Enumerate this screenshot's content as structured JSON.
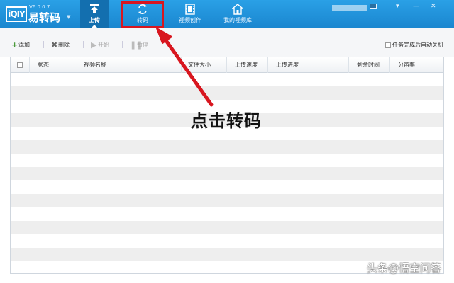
{
  "app": {
    "version": "V6.0.0.7",
    "name": "易转码",
    "logo_text": "iQIY"
  },
  "tabs": [
    {
      "label": "上传",
      "icon": "upload-icon",
      "active": true
    },
    {
      "label": "转码",
      "icon": "convert-icon",
      "active": false
    },
    {
      "label": "视频创作",
      "icon": "film-icon",
      "active": false
    },
    {
      "label": "我的视频库",
      "icon": "home-icon",
      "active": false
    }
  ],
  "window_controls": {
    "settings": "▾",
    "minimize": "—",
    "close": "✕"
  },
  "toolbar": {
    "add_label": "添加",
    "delete_label": "删除",
    "start_label": "开始",
    "pause_label": "暂停",
    "auto_close_label": "任务完成后自动关机"
  },
  "table": {
    "columns": [
      "状态",
      "视频名称",
      "文件大小",
      "上传速度",
      "上传进度",
      "剩余时间",
      "分辨率"
    ]
  },
  "annotation": {
    "text": "点击转码"
  },
  "watermark": "头条@悟空问答",
  "colors": {
    "header": "#1a86cf",
    "highlight": "#d8161f",
    "active_tab": "#136faf"
  }
}
